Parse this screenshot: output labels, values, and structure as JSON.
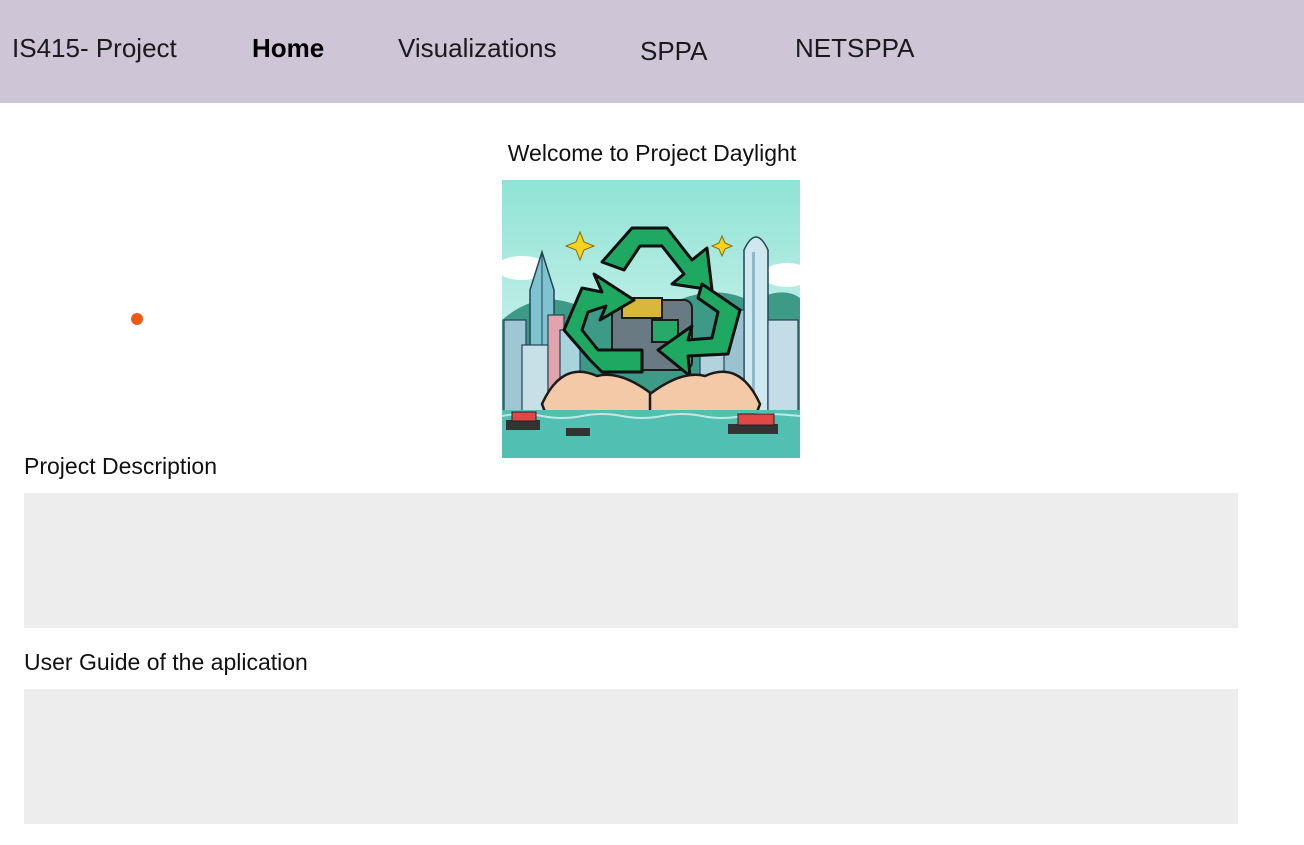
{
  "navbar": {
    "brand": "IS415- Project",
    "items": [
      {
        "label": "Home",
        "active": true
      },
      {
        "label": "Visualizations",
        "active": false
      },
      {
        "label": "SPPA",
        "active": false
      },
      {
        "label": "NETSPPA",
        "active": false
      }
    ],
    "background": "#cec5d6"
  },
  "main": {
    "welcome_title": "Welcome to Project Daylight",
    "hero_image": "recycling-hands-harbour-illustration",
    "description_label": "Project Description",
    "description_text": "",
    "guide_label": "User Guide of the aplication",
    "guide_text": ""
  },
  "colors": {
    "panel": "#ededed",
    "dot": "#ef5a12",
    "recycle_green": "#1fa862"
  }
}
